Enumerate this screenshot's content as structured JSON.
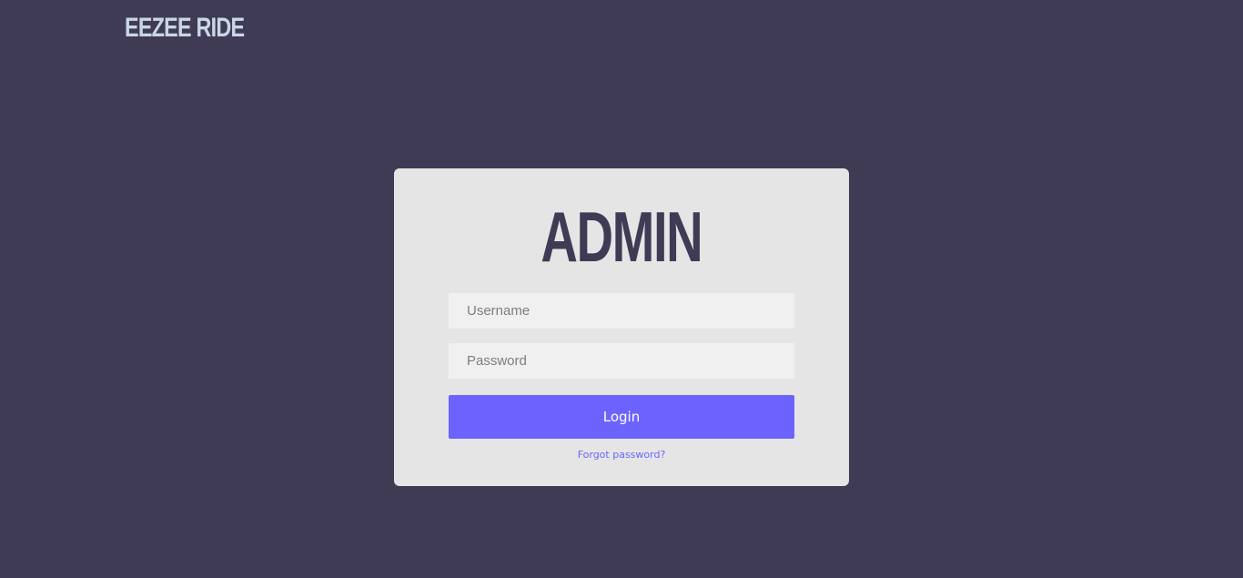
{
  "brand": {
    "logo_text": "EEZEE RIDE"
  },
  "login_card": {
    "title": "ADMIN",
    "username_placeholder": "Username",
    "username_value": "",
    "password_placeholder": "Password",
    "password_value": "",
    "login_label": "Login",
    "forgot_label": "Forgot password?"
  },
  "colors": {
    "background": "#3f3b55",
    "card": "#e5e5e5",
    "accent": "#6c63ff",
    "logo": "#c9d6e8"
  }
}
